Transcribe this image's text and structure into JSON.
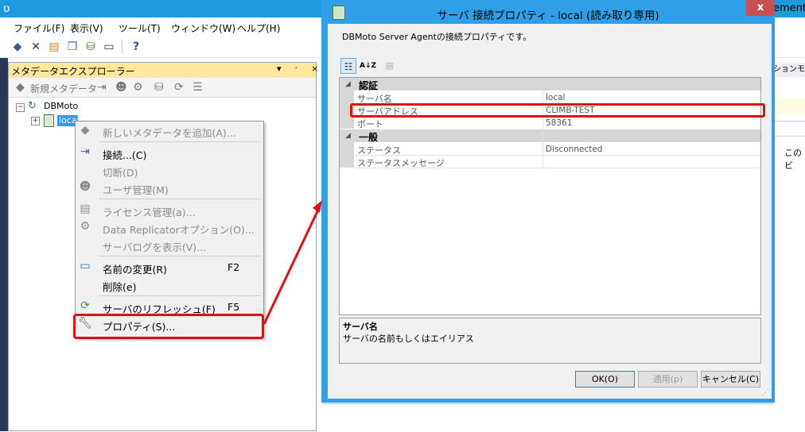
{
  "app": {
    "title_right": "ement",
    "menu": [
      "ファイル(F)",
      "表示(V)",
      "ツール(T)",
      "ウィンドウ(W)",
      "ヘルプ(H)"
    ]
  },
  "explorer": {
    "title": "メタデータエクスプローラー",
    "controls": "▾ ᛫ ×",
    "new_metadata": "新規メタデータ",
    "tree": {
      "root": "DBMoto",
      "child": "local"
    }
  },
  "context_menu": {
    "items": [
      {
        "label": "新しいメタデータを追加(A)...",
        "shortcut": "",
        "enabled": false
      },
      {
        "label": "接続...(C)",
        "shortcut": "",
        "enabled": true
      },
      {
        "label": "切断(D)",
        "shortcut": "",
        "enabled": false
      },
      {
        "label": "ユーザ管理(M)",
        "shortcut": "",
        "enabled": false
      },
      {
        "label": "ライセンス管理(a)...",
        "shortcut": "",
        "enabled": false
      },
      {
        "label": "Data Replicatorオプション(O)...",
        "shortcut": "",
        "enabled": false
      },
      {
        "label": "サーバログを表示(V)...",
        "shortcut": "",
        "enabled": false
      },
      {
        "label": "名前の変更(R)",
        "shortcut": "F2",
        "enabled": true
      },
      {
        "label": "削除(e)",
        "shortcut": "",
        "enabled": true
      },
      {
        "label": "サーバのリフレッシュ(F)",
        "shortcut": "F5",
        "enabled": true
      },
      {
        "label": "プロパティ(S)...",
        "shortcut": "",
        "enabled": true
      }
    ]
  },
  "dialog": {
    "title": "サーバ 接続プロパティ - local (読み取り専用)",
    "close": "x",
    "description": "DBMoto Server Agentの接続プロパティです。",
    "sort_button": "A↓Z",
    "categories": [
      {
        "name": "認証",
        "properties": [
          {
            "name": "サーバ名",
            "value": "local"
          },
          {
            "name": "サーバアドレス",
            "value": "CLIMB-TEST"
          },
          {
            "name": "ポート",
            "value": "58361"
          }
        ]
      },
      {
        "name": "一般",
        "properties": [
          {
            "name": "ステータス",
            "value": "Disconnected"
          },
          {
            "name": "ステータスメッセージ",
            "value": ""
          }
        ]
      }
    ],
    "help": {
      "title": "サーバ名",
      "text": "サーバの名前もしくはエイリアス"
    },
    "buttons": {
      "ok": "OK(O)",
      "apply": "適用(p)",
      "cancel": "キャンセル(C)"
    }
  },
  "right_panel": {
    "header": "ションモ",
    "text": "このビ"
  },
  "colors": {
    "highlight": "#e01010",
    "title_bar": "#1e9be0",
    "selection": "#3399ff"
  }
}
